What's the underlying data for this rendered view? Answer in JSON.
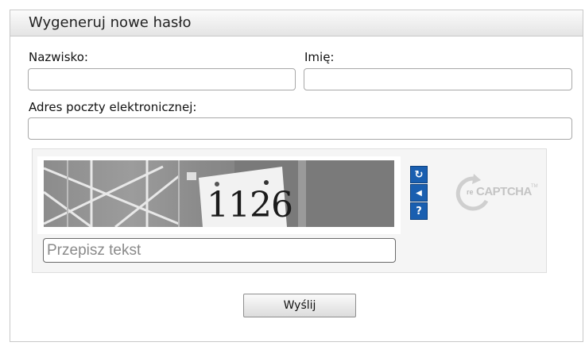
{
  "form": {
    "title": "Wygeneruj nowe hasło",
    "surname_label": "Nazwisko:",
    "first_name_label": "Imię:",
    "email_label": "Adres poczty elektronicznej:",
    "surname_value": "",
    "first_name_value": "",
    "email_value": "",
    "submit_label": "Wyślij"
  },
  "captcha": {
    "image_text": "1126",
    "input_placeholder": "Przepisz tekst",
    "input_value": "",
    "buttons": [
      {
        "icon": "refresh-icon",
        "glyph": "↻"
      },
      {
        "icon": "audio-icon",
        "glyph": "◀"
      },
      {
        "icon": "help-icon",
        "glyph": "?"
      }
    ],
    "logo_text": "CAPTCHA",
    "logo_prefix": "re",
    "logo_tm": "TM"
  },
  "colors": {
    "recaptcha_button": "#1a5fb0",
    "header_bg": "#ececec"
  }
}
